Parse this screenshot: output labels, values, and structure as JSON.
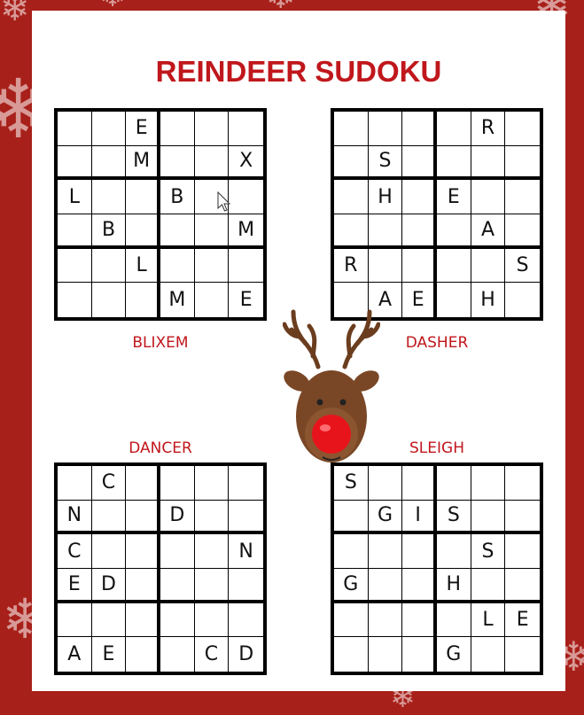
{
  "title": "REINDEER SUDOKU",
  "colors": {
    "background": "#a8201a",
    "accent": "#c0171c"
  },
  "puzzles": [
    {
      "name": "BLIXEM",
      "cells": [
        [
          "",
          "",
          "E",
          "",
          "",
          ""
        ],
        [
          "",
          "",
          "M",
          "",
          "",
          "X"
        ],
        [
          "L",
          "",
          "",
          "B",
          "",
          ""
        ],
        [
          "",
          "B",
          "",
          "",
          "",
          "M"
        ],
        [
          "",
          "",
          "L",
          "",
          "",
          ""
        ],
        [
          "",
          "",
          "",
          "M",
          "",
          "E"
        ]
      ]
    },
    {
      "name": "DASHER",
      "cells": [
        [
          "",
          "",
          "",
          "",
          "R",
          ""
        ],
        [
          "",
          "S",
          "",
          "",
          "",
          ""
        ],
        [
          "",
          "H",
          "",
          "E",
          "",
          ""
        ],
        [
          "",
          "",
          "",
          "",
          "A",
          ""
        ],
        [
          "R",
          "",
          "",
          "",
          "",
          "S"
        ],
        [
          "",
          "A",
          "E",
          "",
          "H",
          ""
        ]
      ]
    },
    {
      "name": "DANCER",
      "cells": [
        [
          "",
          "C",
          "",
          "",
          "",
          ""
        ],
        [
          "N",
          "",
          "",
          "D",
          "",
          ""
        ],
        [
          "C",
          "",
          "",
          "",
          "",
          "N"
        ],
        [
          "E",
          "D",
          "",
          "",
          "",
          ""
        ],
        [
          "",
          "",
          "",
          "",
          "",
          ""
        ],
        [
          "A",
          "E",
          "",
          "",
          "C",
          "D"
        ]
      ]
    },
    {
      "name": "SLEIGH",
      "cells": [
        [
          "S",
          "",
          "",
          "",
          "",
          ""
        ],
        [
          "",
          "G",
          "I",
          "S",
          "",
          ""
        ],
        [
          "",
          "",
          "",
          "",
          "S",
          ""
        ],
        [
          "G",
          "",
          "",
          "H",
          "",
          ""
        ],
        [
          "",
          "",
          "",
          "",
          "L",
          "E"
        ],
        [
          "",
          "",
          "",
          "G",
          "",
          ""
        ]
      ]
    }
  ],
  "icons": [
    "snowflake-icon",
    "reindeer-icon",
    "mouse-cursor-icon"
  ]
}
